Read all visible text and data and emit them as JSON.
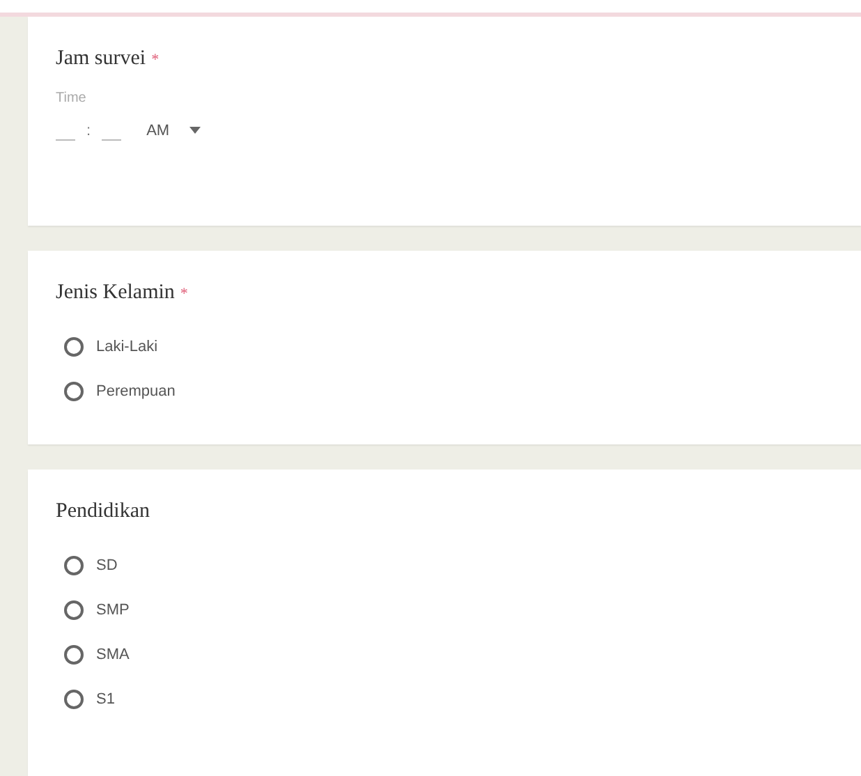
{
  "questions": [
    {
      "kind": "time",
      "title": "Jam survei",
      "required_mark": "*",
      "time_label": "Time",
      "separator": ":",
      "period": "AM"
    },
    {
      "kind": "radio",
      "title": "Jenis Kelamin",
      "required_mark": "*",
      "options": [
        {
          "label": "Laki-Laki",
          "selected": false
        },
        {
          "label": "Perempuan",
          "selected": false
        }
      ]
    },
    {
      "kind": "radio",
      "title": "Pendidikan",
      "options": [
        {
          "label": "SD",
          "selected": false
        },
        {
          "label": "SMP",
          "selected": false
        },
        {
          "label": "SMA",
          "selected": false
        },
        {
          "label": "S1",
          "selected": false
        }
      ]
    }
  ]
}
